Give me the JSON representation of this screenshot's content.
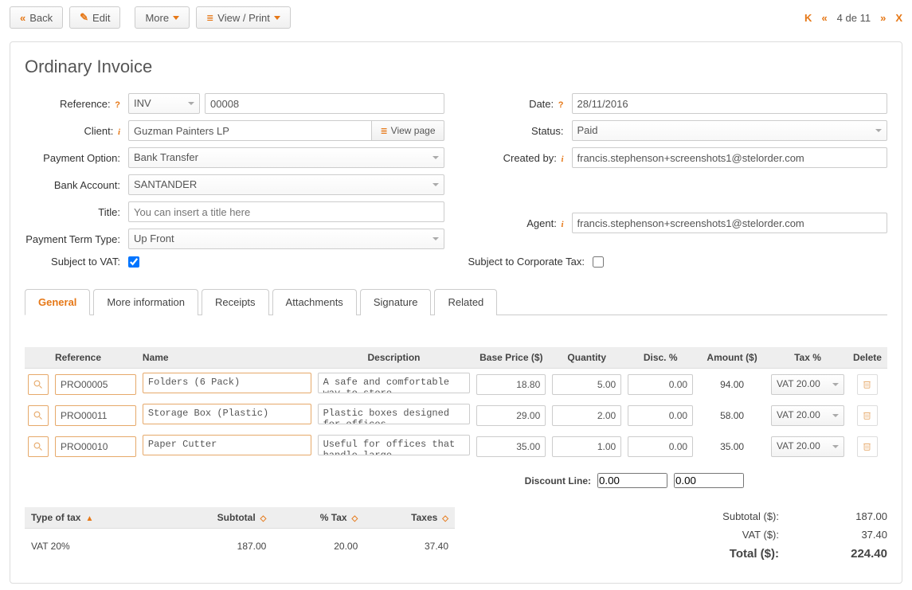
{
  "toolbar": {
    "back": "Back",
    "edit": "Edit",
    "more": "More",
    "view_print": "View / Print"
  },
  "pager": {
    "text": "4 de 11"
  },
  "page_title": "Ordinary Invoice",
  "form": {
    "left": {
      "reference_label": "Reference:",
      "reference_prefix": "INV",
      "reference_number": "00008",
      "client_label": "Client:",
      "client_value": "Guzman Painters LP",
      "view_page": "View page",
      "payment_option_label": "Payment Option:",
      "payment_option_value": "Bank Transfer",
      "bank_account_label": "Bank Account:",
      "bank_account_value": "SANTANDER",
      "title_label": "Title:",
      "title_placeholder": "You can insert a title here",
      "payment_term_label": "Payment Term Type:",
      "payment_term_value": "Up Front",
      "vat_label": "Subject to VAT:",
      "vat_checked": true
    },
    "right": {
      "date_label": "Date:",
      "date_value": "28/11/2016",
      "status_label": "Status:",
      "status_value": "Paid",
      "created_by_label": "Created by:",
      "created_by_value": "francis.stephenson+screenshots1@stelorder.com",
      "agent_label": "Agent:",
      "agent_value": "francis.stephenson+screenshots1@stelorder.com",
      "corp_tax_label": "Subject to Corporate Tax:",
      "corp_tax_checked": false
    }
  },
  "tabs": [
    "General",
    "More information",
    "Receipts",
    "Attachments",
    "Signature",
    "Related"
  ],
  "line_headers": {
    "reference": "Reference",
    "name": "Name",
    "description": "Description",
    "base_price": "Base Price ($)",
    "quantity": "Quantity",
    "disc": "Disc. %",
    "amount": "Amount ($)",
    "tax": "Tax %",
    "delete": "Delete"
  },
  "lines": [
    {
      "ref": "PRO00005",
      "name": "Folders (6 Pack)",
      "desc": "A safe and comfortable way to store",
      "price": "18.80",
      "qty": "5.00",
      "disc": "0.00",
      "amount": "94.00",
      "tax": "VAT 20.00"
    },
    {
      "ref": "PRO00011",
      "name": "Storage Box (Plastic)",
      "desc": "Plastic boxes designed for offices,",
      "price": "29.00",
      "qty": "2.00",
      "disc": "0.00",
      "amount": "58.00",
      "tax": "VAT 20.00"
    },
    {
      "ref": "PRO00010",
      "name": "Paper Cutter",
      "desc": "Useful for offices that handle large",
      "price": "35.00",
      "qty": "1.00",
      "disc": "0.00",
      "amount": "35.00",
      "tax": "VAT 20.00"
    }
  ],
  "discount_line": {
    "label": "Discount Line:",
    "val1": "0.00",
    "val2": "0.00"
  },
  "tax_summary": {
    "headers": {
      "type": "Type of tax",
      "subtotal": "Subtotal",
      "pct": "% Tax",
      "taxes": "Taxes"
    },
    "rows": [
      {
        "type": "VAT 20%",
        "subtotal": "187.00",
        "pct": "20.00",
        "taxes": "37.40"
      }
    ]
  },
  "totals": {
    "subtotal_label": "Subtotal ($):",
    "subtotal_value": "187.00",
    "vat_label": "VAT ($):",
    "vat_value": "37.40",
    "total_label": "Total ($):",
    "total_value": "224.40"
  }
}
